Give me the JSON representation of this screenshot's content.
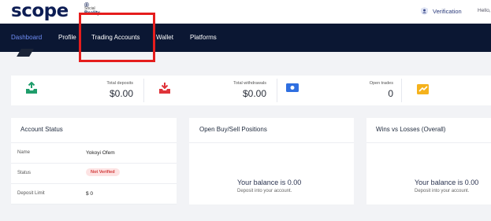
{
  "brand": {
    "name": "scope",
    "registered": "®",
    "tagline_line1": "Social",
    "tagline_line2": "Reality"
  },
  "header": {
    "verification_label": "Verification",
    "hello_text": "Hello,"
  },
  "nav": {
    "items": [
      {
        "label": "Dashboard",
        "active": true
      },
      {
        "label": "Profile",
        "active": false
      },
      {
        "label": "Trading Accounts",
        "active": false
      },
      {
        "label": "Wallet",
        "active": false
      },
      {
        "label": "Platforms",
        "active": false
      }
    ]
  },
  "stats": [
    {
      "label": "Total deposits",
      "value": "$0.00",
      "icon": "download-tray-icon",
      "color": "#1f9d6b"
    },
    {
      "label": "Total withdrawals",
      "value": "$0.00",
      "icon": "upload-tray-icon",
      "color": "#e0343a"
    },
    {
      "label": "Open trades",
      "value": "0",
      "icon": "cash-icon",
      "color": "#2f6fe0"
    },
    {
      "label": "",
      "value": "",
      "icon": "chart-card-icon",
      "color": "#f5b21c"
    }
  ],
  "account_status": {
    "title": "Account Status",
    "rows": [
      {
        "key": "Name",
        "value": "Yokoyi Ofem"
      },
      {
        "key": "Status",
        "value": "Not Verified"
      },
      {
        "key": "Deposit Limit",
        "value": "$ 0"
      }
    ]
  },
  "positions": {
    "title": "Open Buy/Sell Positions",
    "balance": "Your balance is 0.00",
    "hint": "Deposit into your account."
  },
  "wins_losses": {
    "title": "Wins vs Losses (Overall)",
    "balance": "Your balance is 0.00",
    "hint": "Deposit into your account."
  },
  "colors": {
    "nav_bg": "#0b1733",
    "nav_active": "#6f8df5",
    "annotation_box": "#e51d1d"
  }
}
